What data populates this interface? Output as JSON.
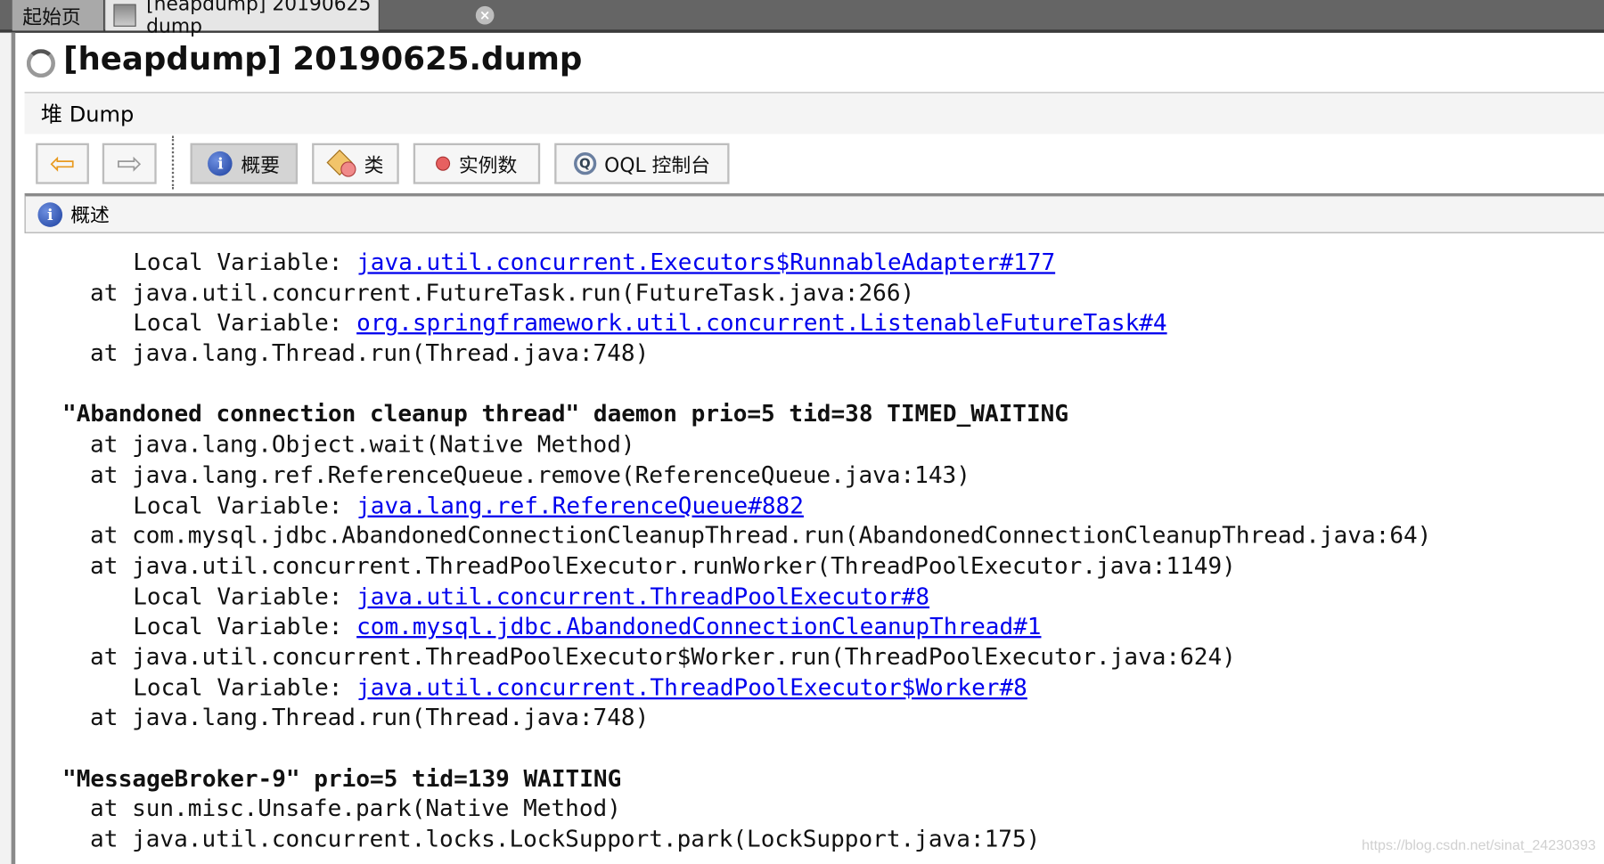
{
  "tabs": [
    {
      "label": "起始页",
      "icon": "close-icon"
    },
    {
      "label": "[heapdump] 20190625 dump",
      "icon": "heapdump-icon"
    }
  ],
  "title": "[heapdump] 20190625.dump",
  "band": "堆 Dump",
  "toolbar": {
    "back": "arrow-left-icon",
    "forward": "arrow-right-icon",
    "summary": "概要",
    "classes": "类",
    "instances": "实例数",
    "oql": "OQL 控制台"
  },
  "section": "概述",
  "lines": [
    {
      "type": "lv",
      "prefix": "Local Variable: ",
      "link": "java.util.concurrent.Executors$RunnableAdapter#177"
    },
    {
      "type": "at",
      "text": "at java.util.concurrent.FutureTask.run(FutureTask.java:266)"
    },
    {
      "type": "lv",
      "prefix": "Local Variable: ",
      "link": "org.springframework.util.concurrent.ListenableFutureTask#4"
    },
    {
      "type": "at",
      "text": "at java.lang.Thread.run(Thread.java:748)"
    },
    {
      "type": "blank"
    },
    {
      "type": "th",
      "text": "\"Abandoned connection cleanup thread\" daemon prio=5 tid=38 TIMED_WAITING"
    },
    {
      "type": "at",
      "text": "at java.lang.Object.wait(Native Method)"
    },
    {
      "type": "at",
      "text": "at java.lang.ref.ReferenceQueue.remove(ReferenceQueue.java:143)"
    },
    {
      "type": "lv",
      "prefix": "Local Variable: ",
      "link": "java.lang.ref.ReferenceQueue#882"
    },
    {
      "type": "at",
      "text": "at com.mysql.jdbc.AbandonedConnectionCleanupThread.run(AbandonedConnectionCleanupThread.java:64)"
    },
    {
      "type": "at",
      "text": "at java.util.concurrent.ThreadPoolExecutor.runWorker(ThreadPoolExecutor.java:1149)"
    },
    {
      "type": "lv",
      "prefix": "Local Variable: ",
      "link": "java.util.concurrent.ThreadPoolExecutor#8"
    },
    {
      "type": "lv",
      "prefix": "Local Variable: ",
      "link": "com.mysql.jdbc.AbandonedConnectionCleanupThread#1"
    },
    {
      "type": "at",
      "text": "at java.util.concurrent.ThreadPoolExecutor$Worker.run(ThreadPoolExecutor.java:624)"
    },
    {
      "type": "lv",
      "prefix": "Local Variable: ",
      "link": "java.util.concurrent.ThreadPoolExecutor$Worker#8"
    },
    {
      "type": "at",
      "text": "at java.lang.Thread.run(Thread.java:748)"
    },
    {
      "type": "blank"
    },
    {
      "type": "th",
      "text": "\"MessageBroker-9\" prio=5 tid=139 WAITING"
    },
    {
      "type": "at",
      "text": "at sun.misc.Unsafe.park(Native Method)"
    },
    {
      "type": "at",
      "text": "at java.util.concurrent.locks.LockSupport.park(LockSupport.java:175)"
    }
  ],
  "watermark": "https://blog.csdn.net/sinat_24230393",
  "colors": {
    "link": "#0000ee",
    "tabbar": "#656565"
  }
}
